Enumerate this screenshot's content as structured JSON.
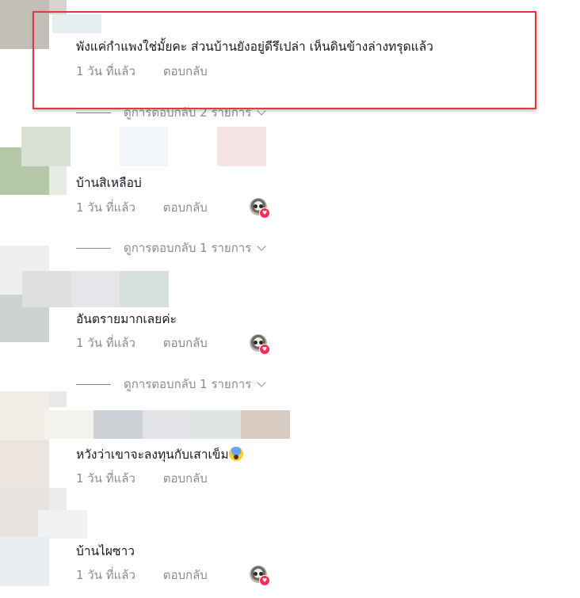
{
  "comments": [
    {
      "text": "พังแค่กำแพงใช่มั้ยคะ ส่วนบ้านยังอยู่ดีรึเปล่า เห็นดินข้างล่างทรุดแล้ว",
      "time": "1 วัน ที่แล้ว",
      "reply_label": "ตอบกลับ",
      "view_replies": "ดูการตอบกลับ 2 รายการ"
    },
    {
      "text": "บ้านสิเหลือบ่",
      "time": "1 วัน ที่แล้ว",
      "reply_label": "ตอบกลับ",
      "view_replies": "ดูการตอบกลับ 1 รายการ",
      "liked_by_creator": true
    },
    {
      "text": "อันตรายมากเลยค่ะ",
      "time": "1 วัน ที่แล้ว",
      "reply_label": "ตอบกลับ",
      "view_replies": "ดูการตอบกลับ 1 รายการ",
      "liked_by_creator": true
    },
    {
      "text": "หวังว่าเขาจะลงทุนกับเสาเข็ม",
      "emoji": "scream-emoji",
      "time": "1 วัน ที่แล้ว",
      "reply_label": "ตอบกลับ"
    },
    {
      "text": "บ้านไผซาว",
      "time": "1 วัน ที่แล้ว",
      "reply_label": "ตอบกลับ",
      "liked_by_creator": true
    }
  ],
  "colors": {
    "text": "#161823",
    "secondary": "#8a8b91",
    "like_heart": "#fe2c55",
    "highlight_border": "#e03a3e"
  },
  "icons": {
    "like_badge": "creator-liked-avatar-icon",
    "expand": "chevron-down-icon"
  }
}
